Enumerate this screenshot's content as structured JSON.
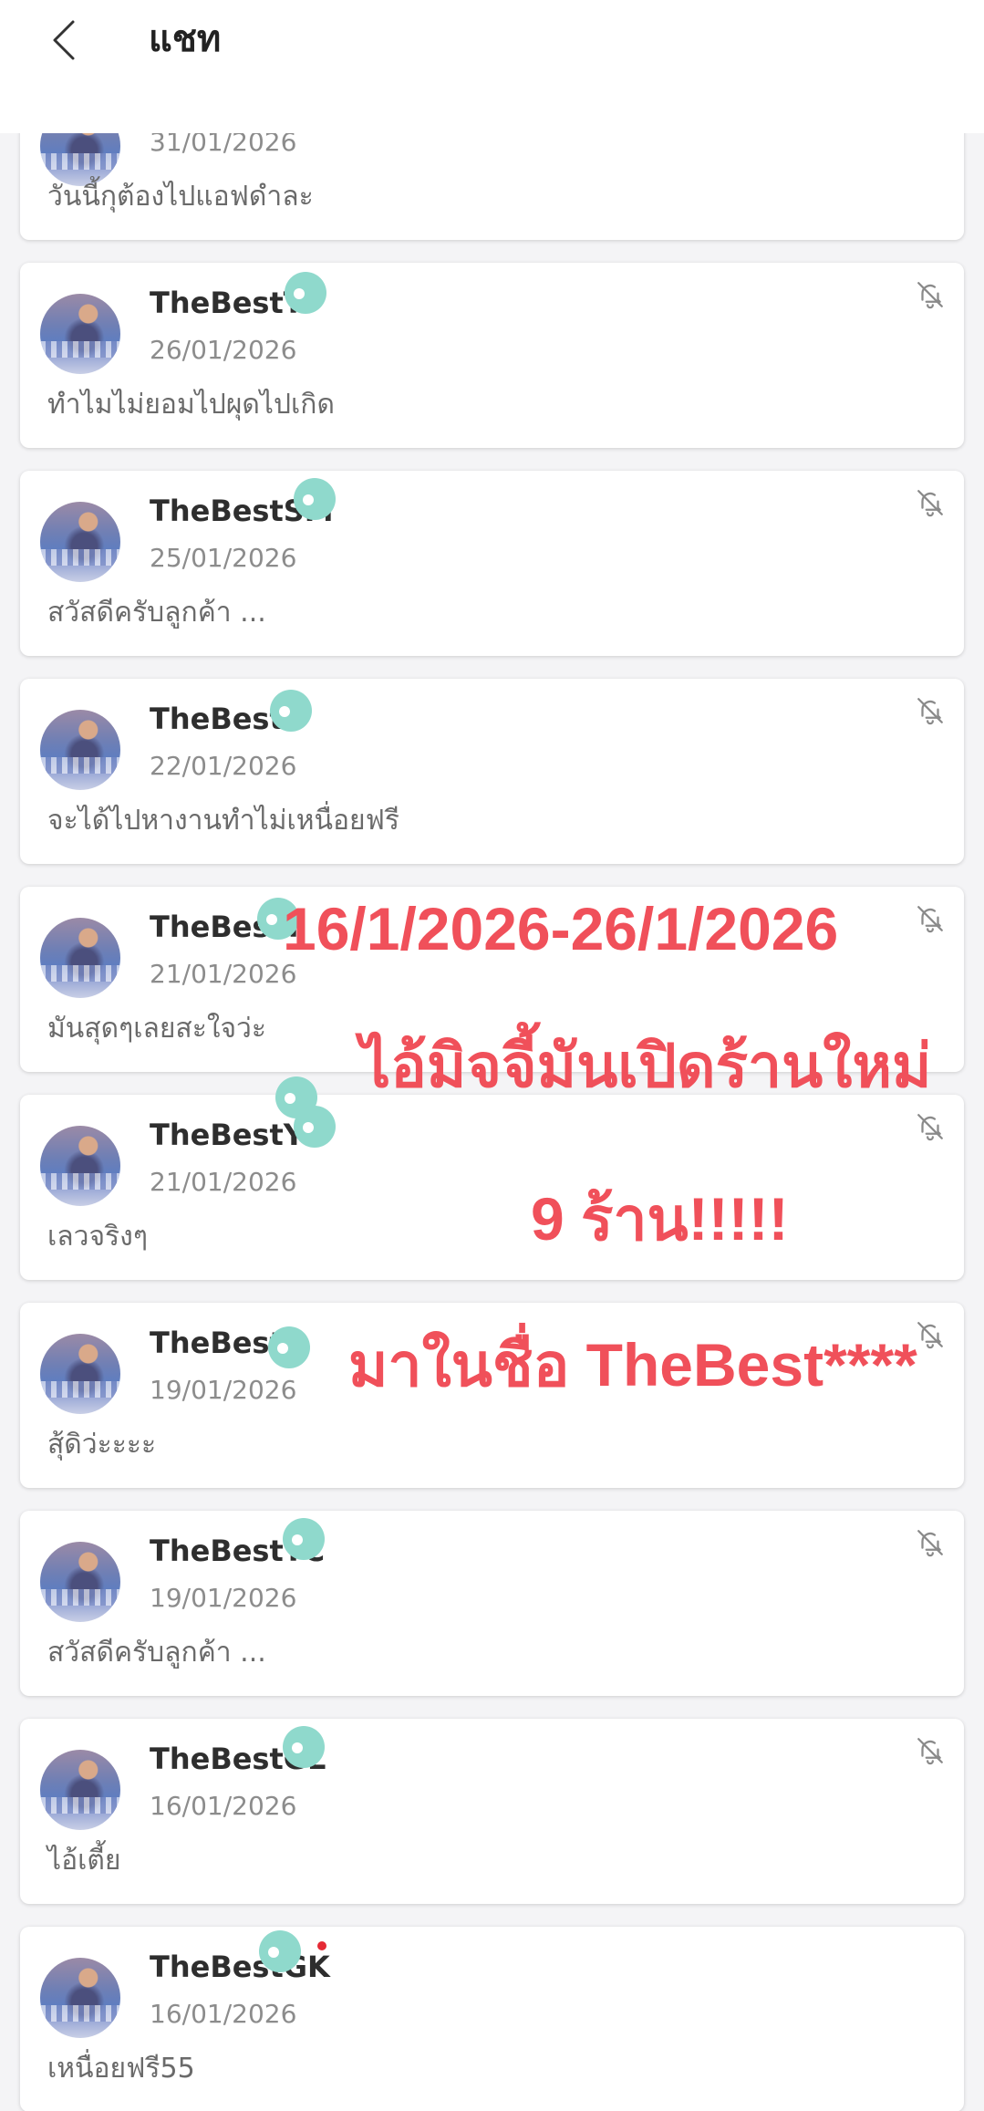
{
  "header": {
    "title": "แชท"
  },
  "chats": [
    {
      "name": "",
      "date": "31/01/2026",
      "preview": "วันนี้กุต้องไปแอฟดำละ"
    },
    {
      "name": "TheBestTr",
      "date": "26/01/2026",
      "preview": "ทำไมไม่ยอมไปผุดไปเกิด"
    },
    {
      "name": "TheBestSM",
      "date": "25/01/2026",
      "preview": "สวัสดีครับลูกค้า ..."
    },
    {
      "name": "TheBestL",
      "date": "22/01/2026",
      "preview": "จะได้ไปหางานทำไม่เหนื่อยฟรี"
    },
    {
      "name": "TheBestT",
      "date": "21/01/2026",
      "preview": "มันสุดๆเลยสะใจว่ะ"
    },
    {
      "name": "TheBestY",
      "date": "21/01/2026",
      "preview": "เลวจริงๆ"
    },
    {
      "name": "TheBestL",
      "date": "19/01/2026",
      "preview": "สุ้ดิว่ะะะะ"
    },
    {
      "name": "TheBestTC",
      "date": "19/01/2026",
      "preview": "สวัสดีครับลูกค้า ..."
    },
    {
      "name": "TheBestGL",
      "date": "16/01/2026",
      "preview": "ไอ้เตี้ย"
    },
    {
      "name": "TheBestGK",
      "date": "16/01/2026",
      "preview": "เหนื่อยฟรี55"
    }
  ],
  "overlay": {
    "line1": "16/1/2026-26/1/2026",
    "line2": "ไอ้มิจจี้มันเปิดร้านใหม่",
    "line3": "9 ร้าน!!!!!",
    "line4": "มาในชื่อ TheBest****"
  },
  "icons": {
    "back": "chevron-left-icon",
    "mute": "bell-off-icon"
  },
  "colors": {
    "overlay_text": "#f0505a",
    "redaction_blob": "#8fd9cc",
    "unread_dot": "#e52a35"
  }
}
